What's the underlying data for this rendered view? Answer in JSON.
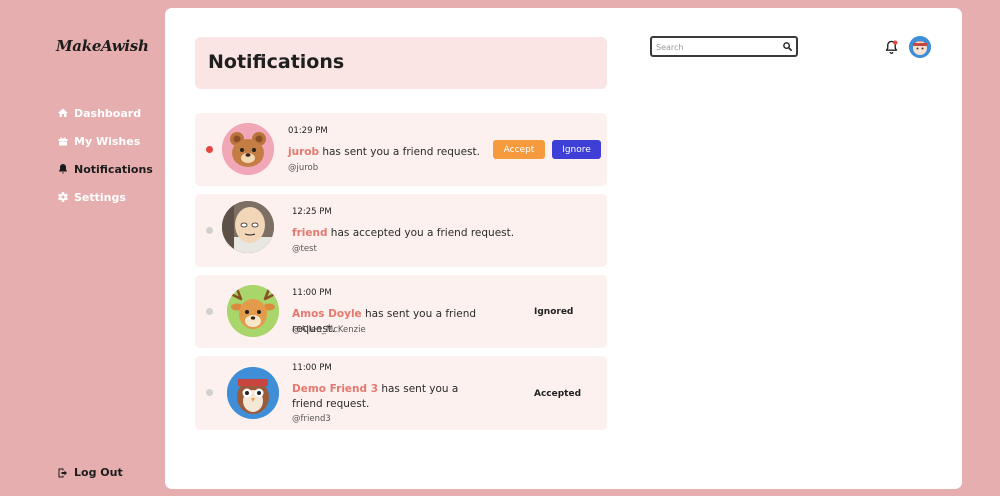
{
  "sidebar": {
    "logo": "MakeAwish",
    "items": [
      {
        "label": "Dashboard",
        "icon": "home-icon"
      },
      {
        "label": "My Wishes",
        "icon": "gift-icon"
      },
      {
        "label": "Notifications",
        "icon": "bell-icon",
        "active": true
      },
      {
        "label": "Settings",
        "icon": "gear-icon"
      }
    ],
    "logout": "Log Out"
  },
  "header": {
    "title": "Notifications",
    "search_placeholder": "Search"
  },
  "notifications": [
    {
      "time": "01:29 PM",
      "name": "jurob",
      "text": " has sent you a friend request.",
      "handle": "@jurob",
      "unread": true,
      "accept_label": "Accept",
      "ignore_label": "Ignore",
      "avatar": "bear-avatar"
    },
    {
      "time": "12:25 PM",
      "name": "friend",
      "text": " has accepted you a friend request.",
      "handle": "@test",
      "unread": false,
      "avatar": "bald-man-avatar"
    },
    {
      "time": "11:00 PM",
      "name": "Amos Doyle",
      "text": " has sent you a friend request.",
      "handle": "@Allen_McKenzie",
      "unread": false,
      "status": "Ignored",
      "avatar": "deer-avatar"
    },
    {
      "time": "11:00 PM",
      "name": "Demo Friend 3",
      "text": " has sent you a friend request.",
      "handle": "@friend3",
      "unread": false,
      "status": "Accepted",
      "avatar": "owl-avatar"
    }
  ],
  "colors": {
    "background": "#e6aeae",
    "name_accent": "#e5786f",
    "accept": "#f59a3d",
    "ignore": "#3d3fd6",
    "unread_dot": "#e6463f"
  }
}
